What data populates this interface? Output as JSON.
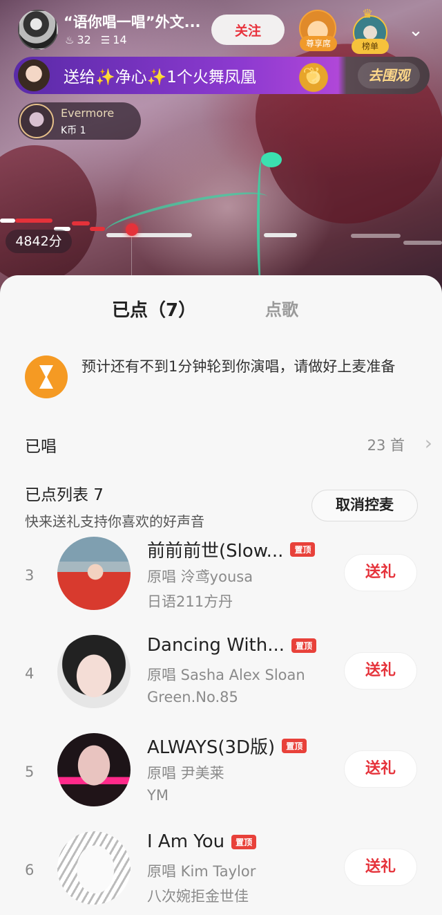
{
  "room": {
    "title": "“语你唱一唱”外文...",
    "heat": "32",
    "members": "14",
    "follow_label": "关注",
    "vip_seat_label": "尊享席",
    "rank_label": "榜单"
  },
  "gift_banner": {
    "prefix": "送给",
    "sparkle": "✨",
    "recipient": "净心",
    "gift": "1个火舞凤凰",
    "watch_label": "去围观"
  },
  "singer": {
    "name": "Evermore",
    "kcoin": "K币 1"
  },
  "score": "4842分",
  "sheet": {
    "tabs": [
      "已点（7）",
      "点歌"
    ],
    "notice": "预计还有不到1分钟轮到你演唱，请做好上麦准备",
    "sung_label": "已唱",
    "sung_count": "23 首",
    "list_title": "已点列表 7",
    "list_subtitle": "快来送礼支持你喜欢的好声音",
    "cancel_mic_label": "取消控麦",
    "pin_label": "置顶",
    "gift_label": "送礼",
    "songs": [
      {
        "index": "3",
        "title": "前前前世(Slow...",
        "original": "原唱 泠鸢yousa",
        "orderer": "日语211方丹"
      },
      {
        "index": "4",
        "title": "Dancing With...",
        "original": "原唱 Sasha Alex Sloan",
        "orderer": "Green.No.85"
      },
      {
        "index": "5",
        "title": "ALWAYS(3D版)",
        "original": "原唱 尹美莱",
        "orderer": "YM"
      },
      {
        "index": "6",
        "title": "I Am You",
        "original": "原唱 Kim Taylor",
        "orderer": "八次婉拒金世佳"
      }
    ]
  },
  "colors": {
    "accent_red": "#e5323a",
    "notice_orange": "#f59a23",
    "banner_purple": "#8d3ad0"
  }
}
